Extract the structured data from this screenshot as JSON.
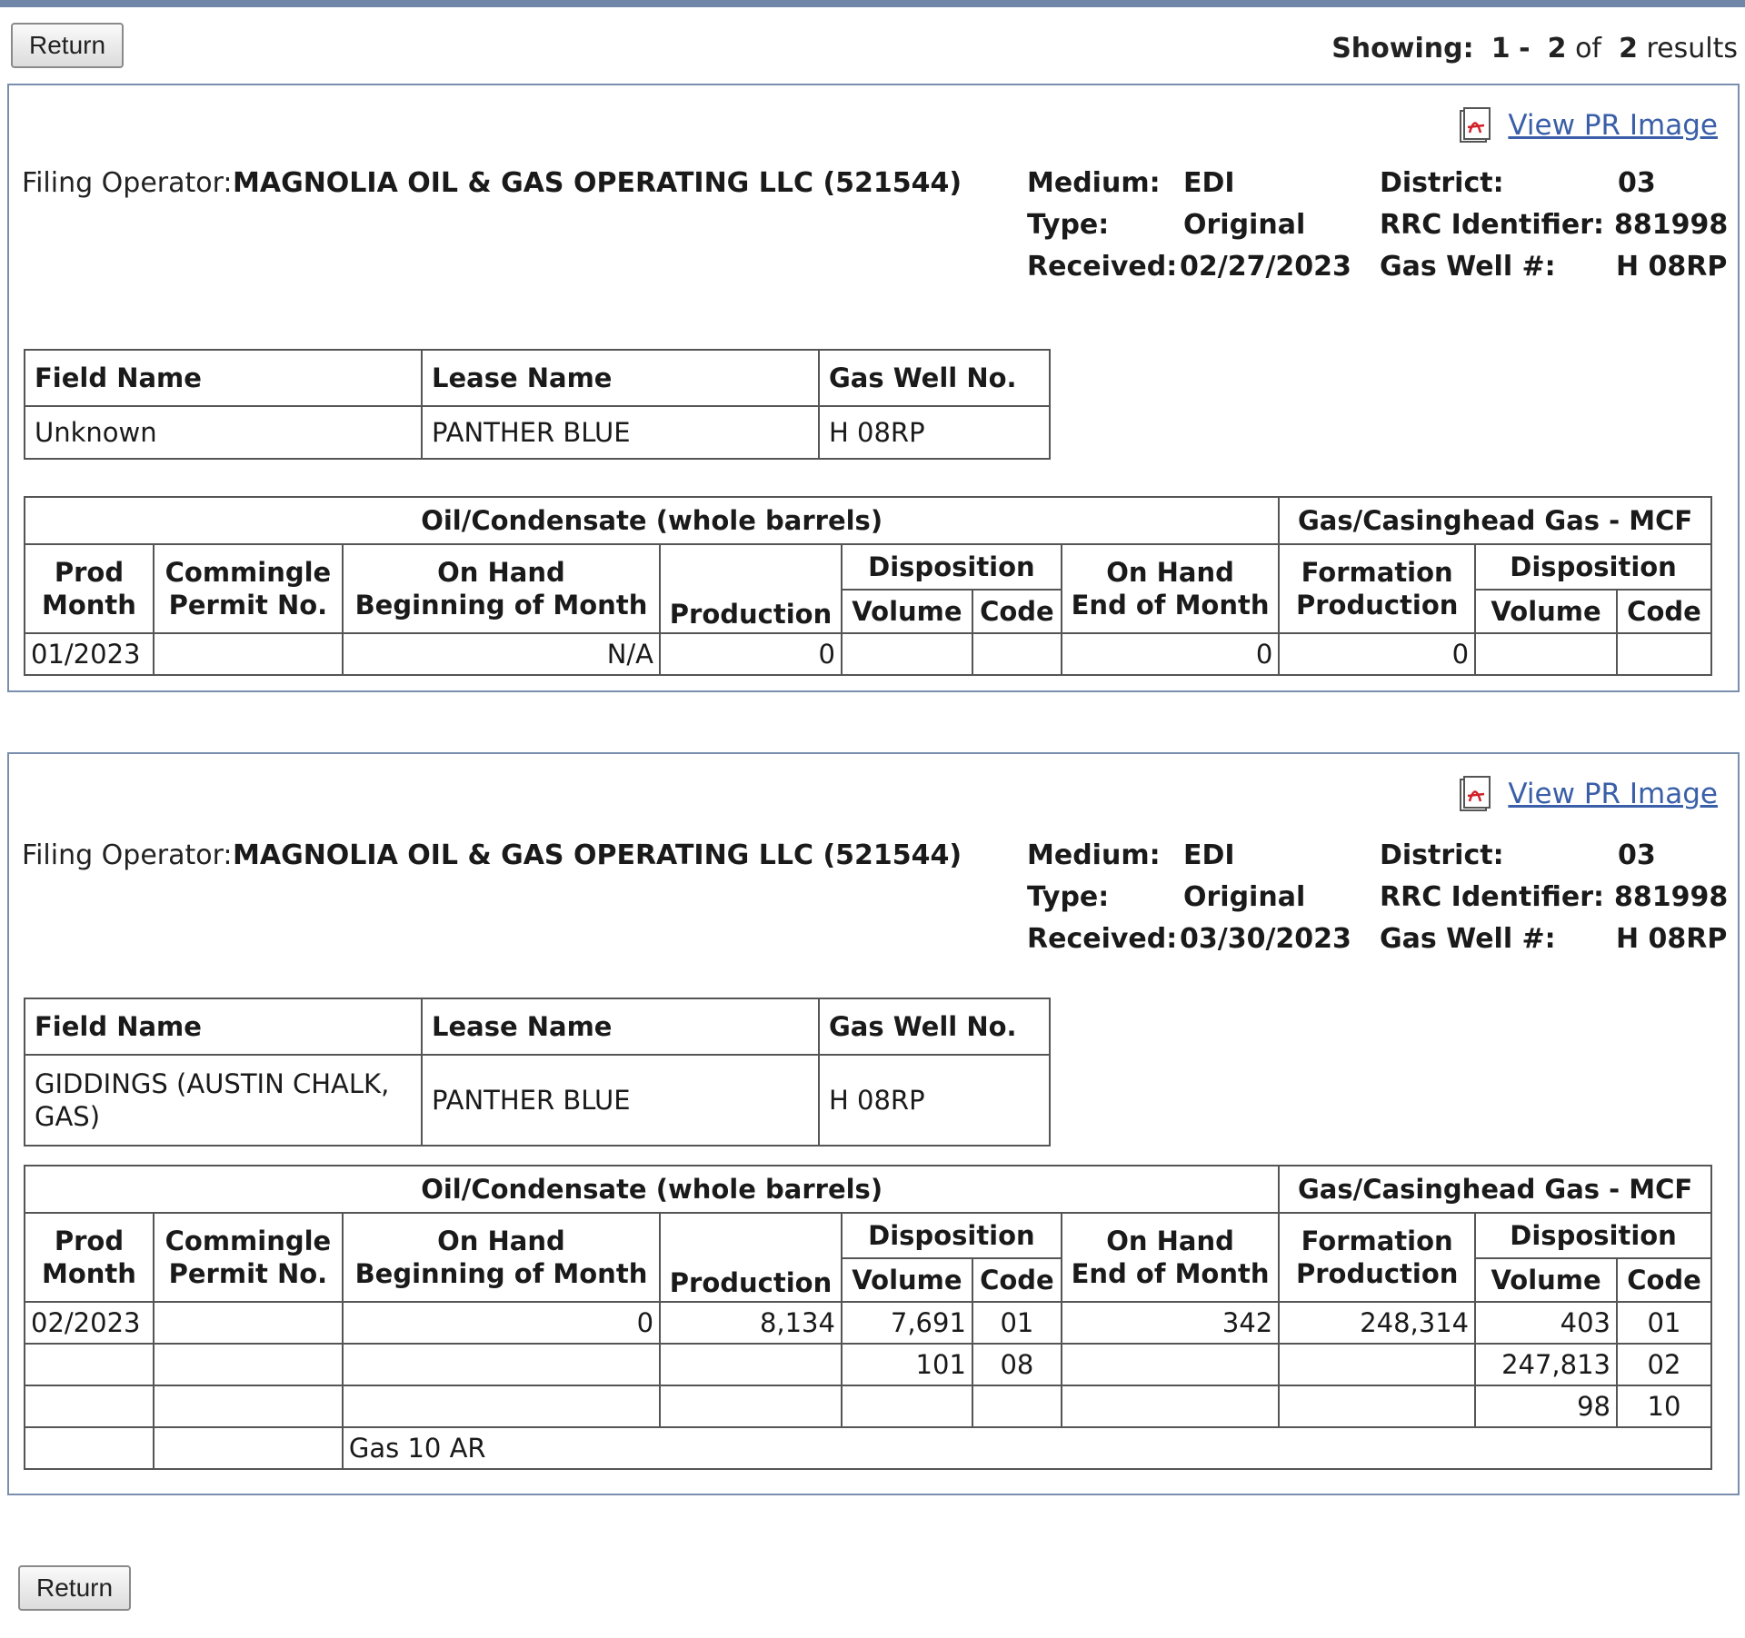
{
  "nav": {
    "return_label": "Return"
  },
  "showing": {
    "prefix": "Showing:",
    "from": "1",
    "dash": "-",
    "to": "2",
    "of": "of",
    "total": "2",
    "suffix": "results"
  },
  "labels": {
    "view_pr_image": "View PR Image",
    "filing_operator": "Filing Operator:",
    "medium": "Medium:",
    "type": "Type:",
    "received": "Received:",
    "district": "District:",
    "rrc_identifier": "RRC Identifier:",
    "gas_well_num": "Gas Well #:",
    "field_name": "Field Name",
    "lease_name": "Lease Name",
    "gas_well_no": "Gas Well No.",
    "oil_condensate": "Oil/Condensate (whole barrels)",
    "gas_casinghead": "Gas/Casinghead Gas - MCF",
    "prod": "Prod",
    "month": "Month",
    "commingle": "Commingle",
    "permit_no": "Permit No.",
    "on_hand": "On Hand",
    "beginning_of_month": "Beginning of Month",
    "production": "Production",
    "disposition": "Disposition",
    "volume": "Volume",
    "code": "Code",
    "end_of_month": "End of Month",
    "formation": "Formation"
  },
  "records": [
    {
      "operator": "MAGNOLIA OIL & GAS OPERATING LLC (521544)",
      "medium": "EDI",
      "type": "Original",
      "received": "02/27/2023",
      "district": "03",
      "rrc_identifier": "881998",
      "gas_well_num": "H 08RP",
      "field_name": "Unknown",
      "lease_name": "PANTHER BLUE",
      "gas_well_no": "H 08RP",
      "rows": [
        [
          "01/2023",
          "",
          "N/A",
          "0",
          "",
          "",
          "0",
          "0",
          "",
          ""
        ]
      ]
    },
    {
      "operator": "MAGNOLIA OIL & GAS OPERATING LLC (521544)",
      "medium": "EDI",
      "type": "Original",
      "received": "03/30/2023",
      "district": "03",
      "rrc_identifier": "881998",
      "gas_well_num": "H 08RP",
      "field_name": "GIDDINGS (AUSTIN CHALK, GAS)",
      "lease_name": "PANTHER BLUE",
      "gas_well_no": "H 08RP",
      "rows": [
        [
          "02/2023",
          "",
          "0",
          "8,134",
          "7,691",
          "01",
          "342",
          "248,314",
          "403",
          "01"
        ],
        [
          "",
          "",
          "",
          "",
          "101",
          "08",
          "",
          "",
          "247,813",
          "02"
        ],
        [
          "",
          "",
          "",
          "",
          "",
          "",
          "",
          "",
          "98",
          "10"
        ]
      ],
      "note": "Gas 10 AR"
    }
  ]
}
